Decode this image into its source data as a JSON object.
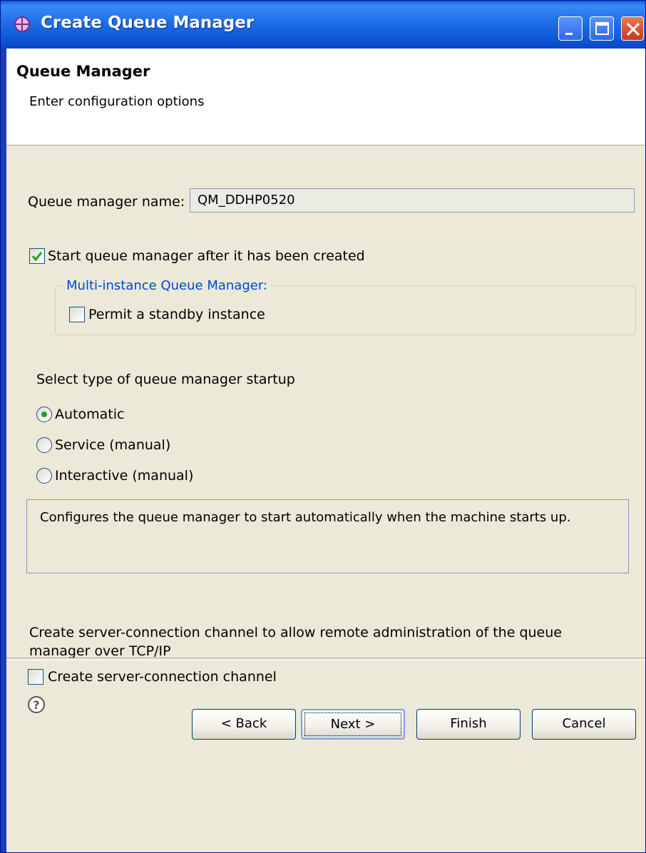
{
  "window": {
    "title": "Create Queue Manager",
    "buttons": {
      "minimize": "minimize",
      "maximize": "maximize",
      "close": "close"
    }
  },
  "header": {
    "title": "Queue Manager",
    "subtitle": "Enter configuration options"
  },
  "form": {
    "qm_name_label": "Queue manager name:",
    "qm_name_value": "QM_DDHP0520",
    "start_after_created_label": "Start queue manager after it has been created",
    "start_after_created_checked": true,
    "multi_instance_group": "Multi-instance Queue Manager:",
    "permit_standby_label": "Permit a standby instance",
    "permit_standby_checked": false,
    "startup_type_label": "Select type of queue manager startup",
    "startup_options": [
      {
        "label": "Automatic",
        "selected": true
      },
      {
        "label": "Service (manual)",
        "selected": false
      },
      {
        "label": "Interactive (manual)",
        "selected": false
      }
    ],
    "description": "Configures the queue manager to start automatically when the machine starts up.",
    "server_conn_text_line1": "Create server-connection channel to allow remote administration of the queue",
    "server_conn_text_line2": "manager over TCP/IP",
    "create_server_conn_label": "Create server-connection channel",
    "create_server_conn_checked": false
  },
  "footer": {
    "help_icon": "help-icon",
    "back_label": "< Back",
    "next_label": "Next >",
    "finish_label": "Finish",
    "cancel_label": "Cancel"
  },
  "colors": {
    "titlebar": "#0a5ddd",
    "dialog_bg": "#ece9d8",
    "group_legend": "#0046d5",
    "radio_dot": "#21a121"
  }
}
